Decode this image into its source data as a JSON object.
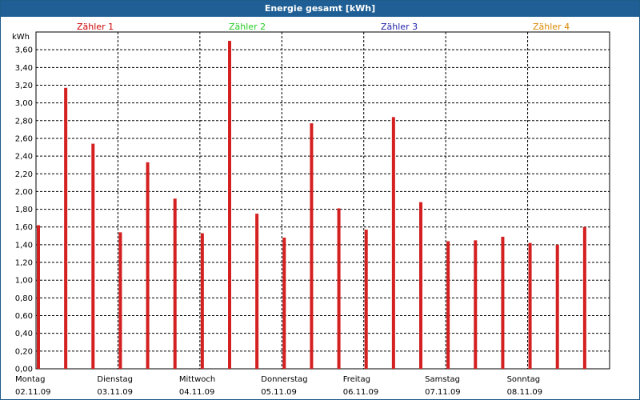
{
  "window": {
    "title": "Energie gesamt [kWh]"
  },
  "legend": [
    {
      "label": "Zähler 1",
      "color": "#cc0000"
    },
    {
      "label": "Zähler 2",
      "color": "#22cc22"
    },
    {
      "label": "Zähler 3",
      "color": "#2222aa"
    },
    {
      "label": "Zähler 4",
      "color": "#dd8800"
    }
  ],
  "chart_data": {
    "type": "bar",
    "ylabel": "kWh",
    "ylim": [
      0,
      3.8
    ],
    "yticks": [
      "0,00",
      "0,20",
      "0,40",
      "0,60",
      "0,80",
      "1,00",
      "1,20",
      "1,40",
      "1,60",
      "1,80",
      "2,00",
      "2,20",
      "2,40",
      "2,60",
      "2,80",
      "3,00",
      "3,20",
      "3,40",
      "3,60"
    ],
    "days": [
      {
        "name": "Montag",
        "date": "02.11.09"
      },
      {
        "name": "Dienstag",
        "date": "03.11.09"
      },
      {
        "name": "Mittwoch",
        "date": "04.11.09"
      },
      {
        "name": "Donnerstag",
        "date": "05.11.09"
      },
      {
        "name": "Freitag",
        "date": "06.11.09"
      },
      {
        "name": "Samstag",
        "date": "07.11.09"
      },
      {
        "name": "Sonntag",
        "date": "08.11.09"
      }
    ],
    "grid": true,
    "bar_color": "#d42020",
    "values": [
      1.62,
      3.17,
      2.54,
      1.54,
      2.33,
      1.92,
      1.53,
      3.7,
      1.75,
      1.48,
      2.77,
      1.81,
      1.57,
      2.84,
      1.88,
      1.44,
      1.45,
      1.49,
      1.42,
      1.4,
      1.6
    ]
  }
}
